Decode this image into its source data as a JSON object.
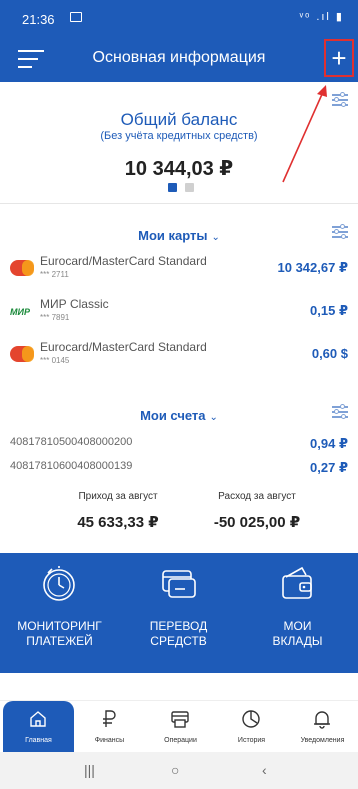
{
  "status": {
    "time": "21:36",
    "icons": "ᵛᵒ .ıl ▮"
  },
  "header": {
    "title": "Основная информация",
    "add_label": "+"
  },
  "balance": {
    "title": "Общий баланс",
    "subtitle": "(Без учёта кредитных средств)",
    "value": "10 344,03 ₽"
  },
  "cards": {
    "title": "Мои карты",
    "chevron": "⌄",
    "items": [
      {
        "name": "Eurocard/MasterCard Standard",
        "number": "*** 2711",
        "amount": "10 342,67 ₽",
        "icon": "mastercard-icon"
      },
      {
        "name": "МИР Classic",
        "number": "*** 7891",
        "amount": "0,15 ₽",
        "icon": "mir-icon",
        "brand": "МИР"
      },
      {
        "name": "Eurocard/MasterCard Standard",
        "number": "*** 0145",
        "amount": "0,60 $",
        "icon": "mastercard-icon"
      }
    ]
  },
  "accounts": {
    "title": "Мои счета",
    "chevron": "⌄",
    "items": [
      {
        "number": "40817810500408000200",
        "amount": "0,94 ₽"
      },
      {
        "number": "40817810600408000139",
        "amount": "0,27 ₽"
      }
    ]
  },
  "flows": {
    "income_label": "Приход за август",
    "income_value": "45 633,33 ₽",
    "expense_label": "Расход за август",
    "expense_value": "-50 025,00 ₽"
  },
  "tiles": [
    {
      "line1": "МОНИТОРИНГ",
      "line2": "ПЛАТЕЖЕЙ",
      "icon": "timer-icon"
    },
    {
      "line1": "ПЕРЕВОД",
      "line2": "СРЕДСТВ",
      "icon": "card-transfer-icon"
    },
    {
      "line1": "МОИ",
      "line2": "ВКЛАДЫ",
      "icon": "wallet-icon"
    }
  ],
  "nav": [
    {
      "label": "Главная",
      "icon": "home-icon",
      "active": true
    },
    {
      "label": "Финансы",
      "icon": "ruble-icon"
    },
    {
      "label": "Операции",
      "icon": "printer-icon"
    },
    {
      "label": "История",
      "icon": "history-icon"
    },
    {
      "label": "Уведомления",
      "icon": "bell-icon"
    }
  ],
  "system": {
    "recents": "|||",
    "home": "○",
    "back": "‹"
  },
  "colors": {
    "primary": "#1e5bb8",
    "annotation": "#e03030"
  }
}
